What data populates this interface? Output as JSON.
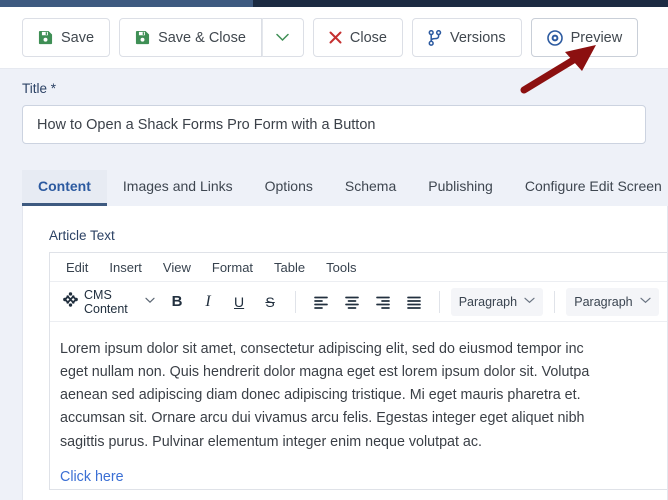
{
  "admin_bar": {
    "left_color": "#3e5a80",
    "right_color": "#1c2b42"
  },
  "toolbar": {
    "save_label": "Save",
    "save_close_label": "Save & Close",
    "dropdown_caret": "⌄",
    "close_label": "Close",
    "versions_label": "Versions",
    "preview_label": "Preview",
    "icons": {
      "save": "floppy-disk-icon",
      "save_close": "floppy-disk-icon",
      "caret": "chevron-down-icon",
      "close": "x-icon",
      "versions": "code-branch-icon",
      "preview": "eye-icon"
    },
    "colors": {
      "save_icon": "#3f8f55",
      "close_icon": "#c53030",
      "versions_icon": "#2c5aa0",
      "preview_icon": "#2c5aa0"
    }
  },
  "annotation": {
    "type": "arrow",
    "color": "#8c1010",
    "points_to": "Preview"
  },
  "title_field": {
    "label": "Title *",
    "value": "How to Open a Shack Forms Pro Form with a Button",
    "placeholder": "Title"
  },
  "tabs": {
    "active": "Content",
    "items": [
      {
        "label": "Content"
      },
      {
        "label": "Images and Links"
      },
      {
        "label": "Options"
      },
      {
        "label": "Schema"
      },
      {
        "label": "Publishing"
      },
      {
        "label": "Configure Edit Screen"
      }
    ]
  },
  "editor": {
    "field_label": "Article Text",
    "menu": [
      {
        "label": "Edit"
      },
      {
        "label": "Insert"
      },
      {
        "label": "View"
      },
      {
        "label": "Format"
      },
      {
        "label": "Table"
      },
      {
        "label": "Tools"
      }
    ],
    "toolbar": {
      "cms_button_label": "CMS Content",
      "cms_icon": "joomla-logo-icon",
      "bold": "B",
      "italic": "I",
      "underline": "U",
      "strikethrough": "S",
      "align_left": "align-left-icon",
      "align_center": "align-center-icon",
      "align_right": "align-right-icon",
      "align_justify": "align-justify-icon",
      "block_format_value": "Paragraph",
      "font_family_value": "Paragraph",
      "chevron": "⌄"
    },
    "content": {
      "paragraph_line1": "Lorem ipsum dolor sit amet, consectetur adipiscing elit, sed do eiusmod tempor inc",
      "paragraph_line2": "eget nullam non. Quis hendrerit dolor magna eget est lorem ipsum dolor sit. Volutpa",
      "paragraph_line3": "aenean sed adipiscing diam donec adipiscing tristique. Mi eget mauris pharetra et.",
      "paragraph_line4": "accumsan sit. Ornare arcu dui vivamus arcu felis. Egestas integer eget aliquet nibh",
      "paragraph_line5": "sagittis purus. Pulvinar elementum integer enim neque volutpat ac.",
      "link_text": "Click here"
    }
  }
}
